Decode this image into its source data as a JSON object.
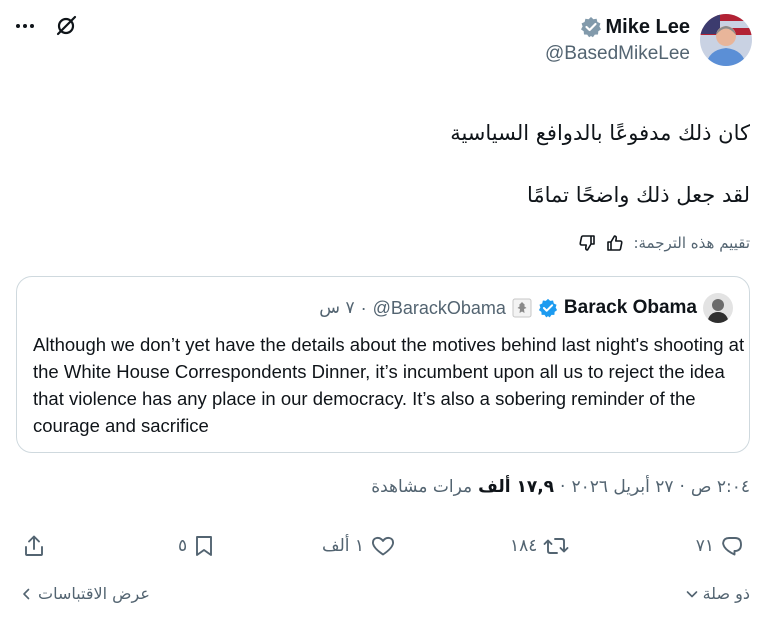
{
  "author": {
    "name": "Mike Lee",
    "handle": "@BasedMikeLee",
    "verified": true,
    "verified_color": "#829aab"
  },
  "tweet": {
    "line1": "كان ذلك مدفوعًا بالدوافع السياسية",
    "line2": "لقد جعل ذلك واضحًا تمامًا"
  },
  "translation_rating": {
    "label": "تقييم هذه الترجمة:",
    "thumb_up_icon": "thumb-up-icon",
    "thumb_down_icon": "thumb-down-icon"
  },
  "quoted": {
    "name": "Barack Obama",
    "handle": "@BarackObama",
    "verified_color": "#1d9bf0",
    "affiliation_icon": "us-seal-icon",
    "separator": "·",
    "time": "٧ س",
    "text": "Although we don’t yet have the details about the motives behind last night's shooting at the White House Correspondents Dinner, it’s incumbent upon all us to reject the idea that violence has any place in our democracy. It’s also a sobering reminder of the courage and sacrifice"
  },
  "meta": {
    "time": "٢:٠٤ ص",
    "date": "٢٧ أبريل ٢٠٢٦",
    "views_number": "١٧,٩ ألف",
    "views_label": "مرات مشاهدة",
    "separator": "·"
  },
  "actions": {
    "replies": "٧١",
    "reposts": "١٨٤",
    "likes": "١ ألف",
    "bookmarks": "٥"
  },
  "footer": {
    "related": "ذو صلة",
    "view_quotes": "عرض الاقتباسات"
  },
  "colors": {
    "text": "#0f1419",
    "secondary": "#536471",
    "border": "#cfd9de"
  }
}
